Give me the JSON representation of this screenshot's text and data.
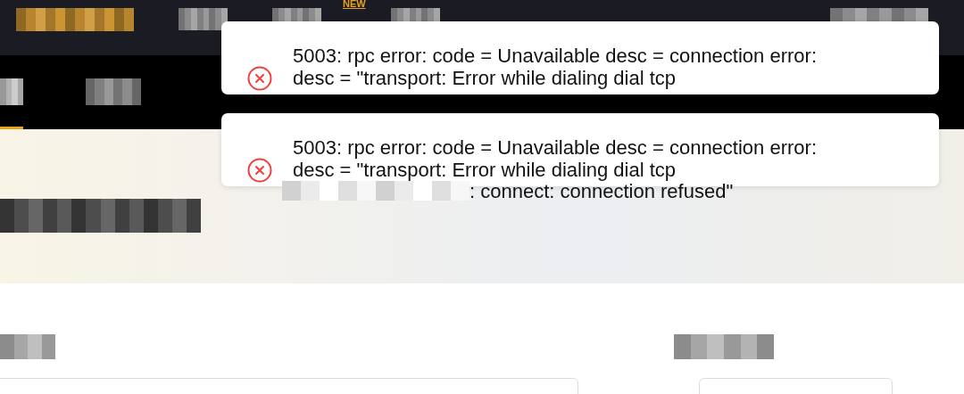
{
  "nav": {
    "badge": "NEW"
  },
  "toasts": [
    {
      "kind": "error",
      "lines": [
        {
          "text": "5003: rpc error: code = Unavailable desc = connection error:",
          "redacted": false
        },
        {
          "text": "desc = \"transport: Error while dialing dial tcp",
          "redacted": false
        }
      ]
    },
    {
      "kind": "error",
      "lines": [
        {
          "text": "5003: rpc error: code = Unavailable desc = connection error:",
          "redacted": false
        },
        {
          "text": "desc = \"transport: Error while dialing dial tcp",
          "redacted": false
        },
        {
          "text": ": connect: connection refused\"",
          "redacted": true
        }
      ]
    }
  ]
}
